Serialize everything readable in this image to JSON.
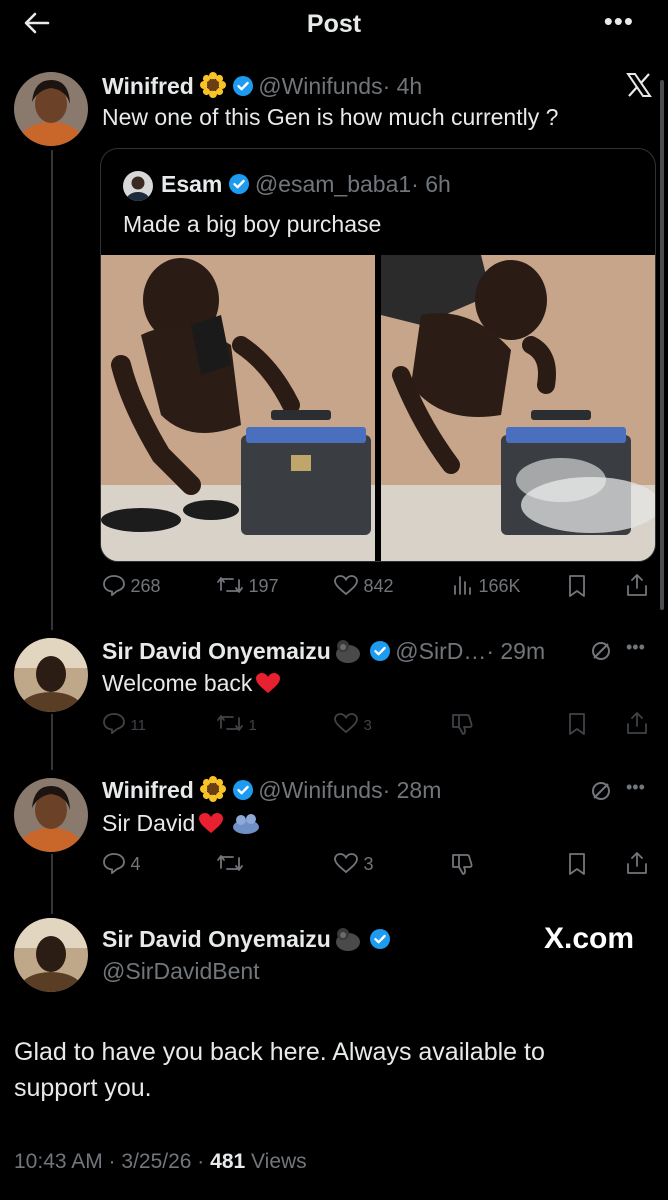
{
  "header": {
    "title": "Post",
    "more": "•••"
  },
  "thread": [
    {
      "name": "Winifred",
      "handle": "@Winifunds",
      "time": "· 4h",
      "text": "New one of this Gen is how much currently ?",
      "quote": {
        "name": "Esam",
        "handle": "@esam_baba1",
        "time": "· 6h",
        "text": "Made a big boy purchase"
      },
      "metrics": {
        "replies": "268",
        "reposts": "197",
        "likes": "842",
        "views": "166K"
      }
    },
    {
      "name": "Sir David Onyemaizu",
      "handle": "@SirD…",
      "time": "· 29m",
      "text": "Welcome back",
      "metrics": {
        "replies": "11",
        "reposts": "1",
        "likes": "3"
      }
    },
    {
      "name": "Winifred",
      "handle": "@Winifunds",
      "time": "· 28m",
      "text": "Sir David",
      "metrics": {
        "replies": "4",
        "likes": "3"
      }
    }
  ],
  "main_post": {
    "name": "Sir David Onyemaizu",
    "handle": "@SirDavidBent",
    "watermark": "X.com",
    "text": "Glad to have you back here. Always available to support you.",
    "time": "10:43 AM · 3/25/26 ·",
    "views_count": "481",
    "views_label": "Views"
  },
  "colors": {
    "background": "#000000",
    "text": "#e7e9ea",
    "muted": "#71767b",
    "verified": "#1d9bf0",
    "border": "#2f3336"
  }
}
